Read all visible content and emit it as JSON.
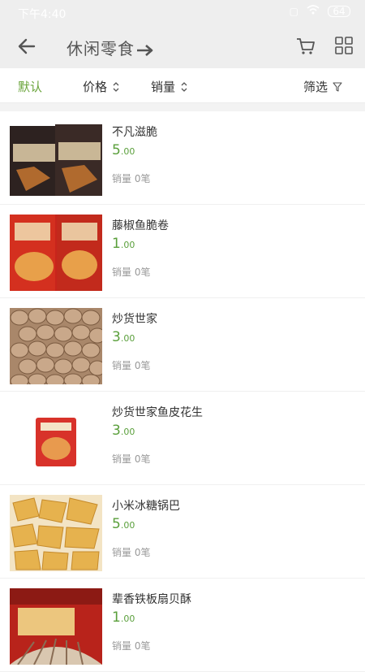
{
  "status": {
    "time": "下午4:40",
    "battery": "64"
  },
  "header": {
    "title": "休闲零食"
  },
  "filters": {
    "default": "默认",
    "price": "价格",
    "sales": "销量",
    "filter": "筛选"
  },
  "products": [
    {
      "name": "不凡滋脆",
      "price_int": "5",
      "price_dec": ".00",
      "sales": "销量 0笔"
    },
    {
      "name": "藤椒鱼脆卷",
      "price_int": "1",
      "price_dec": ".00",
      "sales": "销量 0笔"
    },
    {
      "name": "炒货世家",
      "price_int": "3",
      "price_dec": ".00",
      "sales": "销量 0笔"
    },
    {
      "name": "炒货世家鱼皮花生",
      "price_int": "3",
      "price_dec": ".00",
      "sales": "销量 0笔"
    },
    {
      "name": "小米冰糖锅巴",
      "price_int": "5",
      "price_dec": ".00",
      "sales": "销量 0笔"
    },
    {
      "name": "辈香铁板扇贝酥",
      "price_int": "1",
      "price_dec": ".00",
      "sales": "销量 0笔"
    }
  ],
  "colors": {
    "accent": "#6aa43b",
    "price": "#5a9f3b",
    "toolbar_bg": "#eeeeee"
  }
}
